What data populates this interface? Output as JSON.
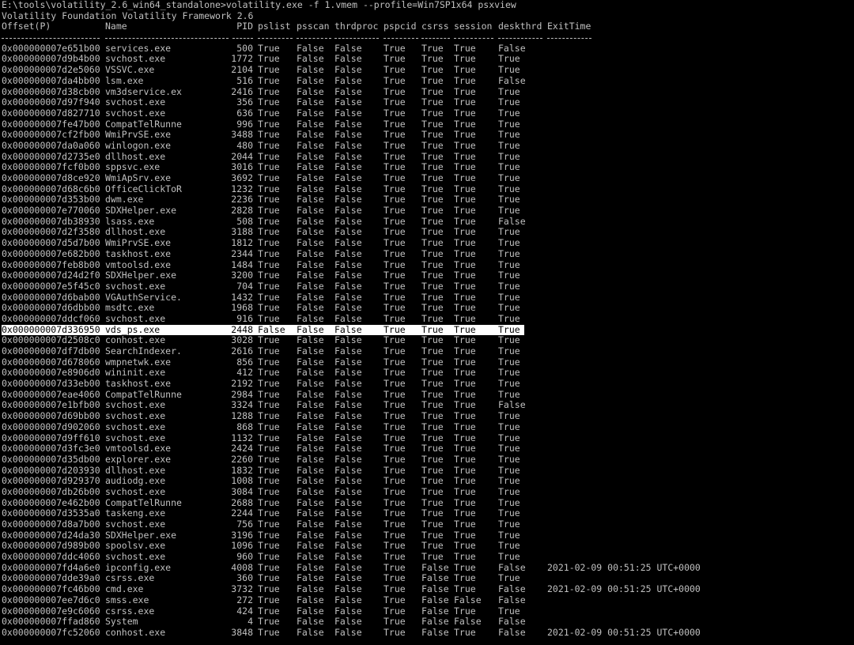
{
  "console": {
    "prompt_line": "E:\\tools\\volatility_2.6_win64_standalone>volatility.exe -f 1.vmem --profile=Win7SP1x64 psxview",
    "banner": "Volatility Foundation Volatility Framework 2.6"
  },
  "table": {
    "headers": {
      "offset": "Offset(P)",
      "name": "Name",
      "pid": "PID",
      "pslist": "pslist",
      "psscan": "psscan",
      "thrdproc": "thrdproc",
      "pspcid": "pspcid",
      "csrss": "csrss",
      "session": "session",
      "deskthrd": "deskthrd",
      "exittime": "ExitTime"
    },
    "highlighted_row": 26,
    "rows": [
      [
        "0x000000007e651b00",
        "services.exe",
        "500",
        "True",
        "False",
        "False",
        "True",
        "True",
        "True",
        "False",
        ""
      ],
      [
        "0x000000007d9b4b00",
        "svchost.exe",
        "1772",
        "True",
        "False",
        "False",
        "True",
        "True",
        "True",
        "True",
        ""
      ],
      [
        "0x000000007d2e5060",
        "VSSVC.exe",
        "2104",
        "True",
        "False",
        "False",
        "True",
        "True",
        "True",
        "True",
        ""
      ],
      [
        "0x000000007da4bb00",
        "lsm.exe",
        "516",
        "True",
        "False",
        "False",
        "True",
        "True",
        "True",
        "False",
        ""
      ],
      [
        "0x000000007d38cb00",
        "vm3dservice.ex",
        "2416",
        "True",
        "False",
        "False",
        "True",
        "True",
        "True",
        "True",
        ""
      ],
      [
        "0x000000007d97f940",
        "svchost.exe",
        "356",
        "True",
        "False",
        "False",
        "True",
        "True",
        "True",
        "True",
        ""
      ],
      [
        "0x000000007d827710",
        "svchost.exe",
        "636",
        "True",
        "False",
        "False",
        "True",
        "True",
        "True",
        "True",
        ""
      ],
      [
        "0x000000007fe47b00",
        "CompatTelRunne",
        "996",
        "True",
        "False",
        "False",
        "True",
        "True",
        "True",
        "True",
        ""
      ],
      [
        "0x000000007cf2fb00",
        "WmiPrvSE.exe",
        "3488",
        "True",
        "False",
        "False",
        "True",
        "True",
        "True",
        "True",
        ""
      ],
      [
        "0x000000007da0a060",
        "winlogon.exe",
        "480",
        "True",
        "False",
        "False",
        "True",
        "True",
        "True",
        "True",
        ""
      ],
      [
        "0x000000007d2735e0",
        "dllhost.exe",
        "2044",
        "True",
        "False",
        "False",
        "True",
        "True",
        "True",
        "True",
        ""
      ],
      [
        "0x000000007fcf0b00",
        "sppsvc.exe",
        "3016",
        "True",
        "False",
        "False",
        "True",
        "True",
        "True",
        "True",
        ""
      ],
      [
        "0x000000007d8ce920",
        "WmiApSrv.exe",
        "3692",
        "True",
        "False",
        "False",
        "True",
        "True",
        "True",
        "True",
        ""
      ],
      [
        "0x000000007d68c6b0",
        "OfficeClickToR",
        "1232",
        "True",
        "False",
        "False",
        "True",
        "True",
        "True",
        "True",
        ""
      ],
      [
        "0x000000007d353b00",
        "dwm.exe",
        "2236",
        "True",
        "False",
        "False",
        "True",
        "True",
        "True",
        "True",
        ""
      ],
      [
        "0x000000007e770060",
        "SDXHelper.exe",
        "2828",
        "True",
        "False",
        "False",
        "True",
        "True",
        "True",
        "True",
        ""
      ],
      [
        "0x000000007db38930",
        "lsass.exe",
        "508",
        "True",
        "False",
        "False",
        "True",
        "True",
        "True",
        "False",
        ""
      ],
      [
        "0x000000007d2f3580",
        "dllhost.exe",
        "3188",
        "True",
        "False",
        "False",
        "True",
        "True",
        "True",
        "True",
        ""
      ],
      [
        "0x000000007d5d7b00",
        "WmiPrvSE.exe",
        "1812",
        "True",
        "False",
        "False",
        "True",
        "True",
        "True",
        "True",
        ""
      ],
      [
        "0x000000007e682b00",
        "taskhost.exe",
        "2344",
        "True",
        "False",
        "False",
        "True",
        "True",
        "True",
        "True",
        ""
      ],
      [
        "0x000000007feb8b00",
        "vmtoolsd.exe",
        "1484",
        "True",
        "False",
        "False",
        "True",
        "True",
        "True",
        "True",
        ""
      ],
      [
        "0x000000007d24d2f0",
        "SDXHelper.exe",
        "3200",
        "True",
        "False",
        "False",
        "True",
        "True",
        "True",
        "True",
        ""
      ],
      [
        "0x000000007e5f45c0",
        "svchost.exe",
        "704",
        "True",
        "False",
        "False",
        "True",
        "True",
        "True",
        "True",
        ""
      ],
      [
        "0x000000007d6bab00",
        "VGAuthService.",
        "1432",
        "True",
        "False",
        "False",
        "True",
        "True",
        "True",
        "True",
        ""
      ],
      [
        "0x000000007d6dbb00",
        "msdtc.exe",
        "1968",
        "True",
        "False",
        "False",
        "True",
        "True",
        "True",
        "True",
        ""
      ],
      [
        "0x000000007ddcf060",
        "svchost.exe",
        "916",
        "True",
        "False",
        "False",
        "True",
        "True",
        "True",
        "True",
        ""
      ],
      [
        "0x000000007d336950",
        "vds_ps.exe",
        "2448",
        "False",
        "False",
        "False",
        "True",
        "True",
        "True",
        "True",
        ""
      ],
      [
        "0x000000007d2508c0",
        "conhost.exe",
        "3028",
        "True",
        "False",
        "False",
        "True",
        "True",
        "True",
        "True",
        ""
      ],
      [
        "0x000000007df7db00",
        "SearchIndexer.",
        "2616",
        "True",
        "False",
        "False",
        "True",
        "True",
        "True",
        "True",
        ""
      ],
      [
        "0x000000007d678060",
        "wmpnetwk.exe",
        "856",
        "True",
        "False",
        "False",
        "True",
        "True",
        "True",
        "True",
        ""
      ],
      [
        "0x000000007e8906d0",
        "wininit.exe",
        "412",
        "True",
        "False",
        "False",
        "True",
        "True",
        "True",
        "True",
        ""
      ],
      [
        "0x000000007d33eb00",
        "taskhost.exe",
        "2192",
        "True",
        "False",
        "False",
        "True",
        "True",
        "True",
        "True",
        ""
      ],
      [
        "0x000000007eae4060",
        "CompatTelRunne",
        "2984",
        "True",
        "False",
        "False",
        "True",
        "True",
        "True",
        "True",
        ""
      ],
      [
        "0x000000007e1bfb00",
        "svchost.exe",
        "3324",
        "True",
        "False",
        "False",
        "True",
        "True",
        "True",
        "False",
        ""
      ],
      [
        "0x000000007d69bb00",
        "svchost.exe",
        "1288",
        "True",
        "False",
        "False",
        "True",
        "True",
        "True",
        "True",
        ""
      ],
      [
        "0x000000007d902060",
        "svchost.exe",
        "868",
        "True",
        "False",
        "False",
        "True",
        "True",
        "True",
        "True",
        ""
      ],
      [
        "0x000000007d9ff610",
        "svchost.exe",
        "1132",
        "True",
        "False",
        "False",
        "True",
        "True",
        "True",
        "True",
        ""
      ],
      [
        "0x000000007d3fc3e0",
        "vmtoolsd.exe",
        "2424",
        "True",
        "False",
        "False",
        "True",
        "True",
        "True",
        "True",
        ""
      ],
      [
        "0x000000007d35db00",
        "explorer.exe",
        "2260",
        "True",
        "False",
        "False",
        "True",
        "True",
        "True",
        "True",
        ""
      ],
      [
        "0x000000007d203930",
        "dllhost.exe",
        "1832",
        "True",
        "False",
        "False",
        "True",
        "True",
        "True",
        "True",
        ""
      ],
      [
        "0x000000007d929370",
        "audiodg.exe",
        "1008",
        "True",
        "False",
        "False",
        "True",
        "True",
        "True",
        "True",
        ""
      ],
      [
        "0x000000007db26b00",
        "svchost.exe",
        "3084",
        "True",
        "False",
        "False",
        "True",
        "True",
        "True",
        "True",
        ""
      ],
      [
        "0x000000007e462b00",
        "CompatTelRunne",
        "2688",
        "True",
        "False",
        "False",
        "True",
        "True",
        "True",
        "True",
        ""
      ],
      [
        "0x000000007d3535a0",
        "taskeng.exe",
        "2244",
        "True",
        "False",
        "False",
        "True",
        "True",
        "True",
        "True",
        ""
      ],
      [
        "0x000000007d8a7b00",
        "svchost.exe",
        "756",
        "True",
        "False",
        "False",
        "True",
        "True",
        "True",
        "True",
        ""
      ],
      [
        "0x000000007d24da30",
        "SDXHelper.exe",
        "3196",
        "True",
        "False",
        "False",
        "True",
        "True",
        "True",
        "True",
        ""
      ],
      [
        "0x000000007d989b00",
        "spoolsv.exe",
        "1096",
        "True",
        "False",
        "False",
        "True",
        "True",
        "True",
        "True",
        ""
      ],
      [
        "0x000000007ddc4060",
        "svchost.exe",
        "960",
        "True",
        "False",
        "False",
        "True",
        "True",
        "True",
        "True",
        ""
      ],
      [
        "0x000000007fd4a6e0",
        "ipconfig.exe",
        "4008",
        "True",
        "False",
        "False",
        "True",
        "False",
        "True",
        "False",
        "2021-02-09 00:51:25 UTC+0000"
      ],
      [
        "0x000000007dde39a0",
        "csrss.exe",
        "360",
        "True",
        "False",
        "False",
        "True",
        "False",
        "True",
        "True",
        ""
      ],
      [
        "0x000000007fc46b00",
        "cmd.exe",
        "3732",
        "True",
        "False",
        "False",
        "True",
        "False",
        "True",
        "False",
        "2021-02-09 00:51:25 UTC+0000"
      ],
      [
        "0x000000007ee7d6c0",
        "smss.exe",
        "272",
        "True",
        "False",
        "False",
        "True",
        "False",
        "False",
        "False",
        ""
      ],
      [
        "0x000000007e9c6060",
        "csrss.exe",
        "424",
        "True",
        "False",
        "False",
        "True",
        "False",
        "True",
        "True",
        ""
      ],
      [
        "0x000000007ffad860",
        "System",
        "4",
        "True",
        "False",
        "False",
        "True",
        "False",
        "False",
        "False",
        ""
      ],
      [
        "0x000000007fc52060",
        "conhost.exe",
        "3848",
        "True",
        "False",
        "False",
        "True",
        "False",
        "True",
        "False",
        "2021-02-09 00:51:25 UTC+0000"
      ]
    ]
  }
}
